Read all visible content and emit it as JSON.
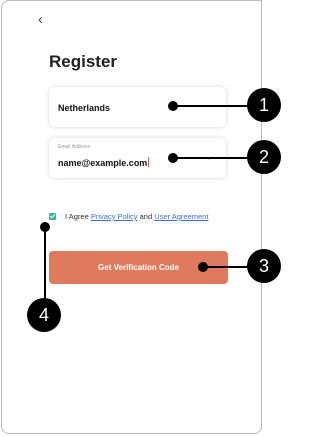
{
  "screen": {
    "back_icon": "chevron-left-icon",
    "title": "Register"
  },
  "country_field": {
    "value": "Netherlands",
    "dropdown_icon": "chevron-down-icon"
  },
  "email_field": {
    "label": "Email Address",
    "value": "name@example.com",
    "dropdown_icon": "chevron-down-icon"
  },
  "agreement": {
    "checked": true,
    "prefix": "I Agree ",
    "privacy_link": "Privacy Policy",
    "middle": " and ",
    "user_link": "User Agreement"
  },
  "primary_button": {
    "label": "Get Verification Code",
    "color": "#e07a5f"
  },
  "callouts": {
    "c1": "1",
    "c2": "2",
    "c3": "3",
    "c4": "4"
  },
  "colors": {
    "accent": "#e07a5f",
    "checkbox": "#3db49d",
    "link": "#3a6fd6"
  }
}
